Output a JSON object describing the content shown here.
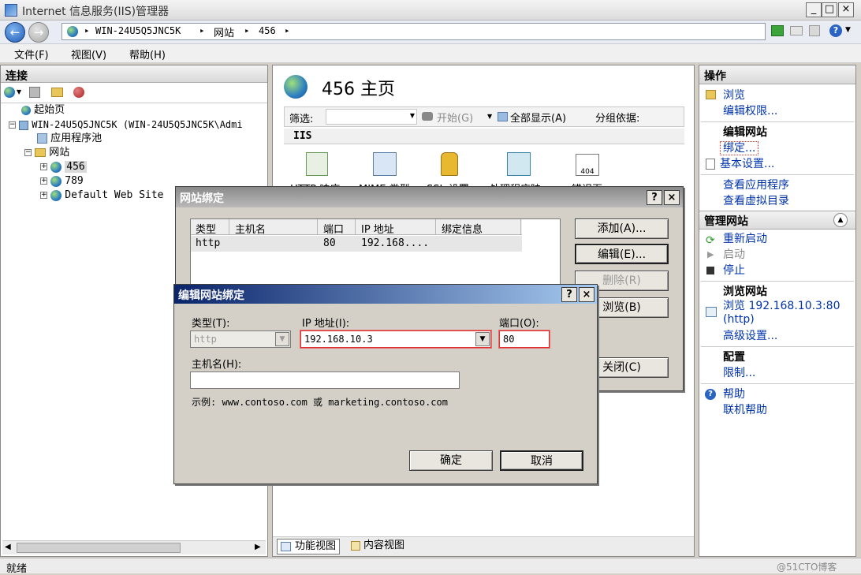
{
  "window": {
    "title": "Internet 信息服务(IIS)管理器",
    "min": "_",
    "max": "□",
    "close": "×"
  },
  "address": {
    "crumbs": [
      "WIN-24U5Q5JNC5K",
      "网站",
      "456"
    ],
    "sep": "▸"
  },
  "menubar": [
    "文件(F)",
    "视图(V)",
    "帮助(H)"
  ],
  "connections": {
    "title": "连接",
    "tree": {
      "start_page": "起始页",
      "server": "WIN-24U5Q5JNC5K (WIN-24U5Q5JNC5K\\Admi",
      "app_pools": "应用程序池",
      "sites": "网站",
      "site_456": "456",
      "site_789": "789",
      "default_site": "Default Web Site"
    }
  },
  "center": {
    "title": "456 主页",
    "filter_label": "筛选:",
    "start_label": "开始(G)",
    "show_all_label": "全部显示(A)",
    "group_label": "分组依据:",
    "section": "IIS",
    "icons": [
      "HTTP 响应",
      "MIME 类型",
      "SSL 设置",
      "处理程序映",
      "错误页"
    ],
    "icon_404": "404",
    "features_view": "功能视图",
    "content_view": "内容视图"
  },
  "actions": {
    "title": "操作",
    "browse": "浏览",
    "edit_permissions": "编辑权限...",
    "edit_site_head": "编辑网站",
    "bindings": "绑定...",
    "basic_settings": "基本设置...",
    "view_apps": "查看应用程序",
    "view_vdirs": "查看虚拟目录",
    "manage_site_head": "管理网站",
    "restart": "重新启动",
    "start": "启动",
    "stop": "停止",
    "browse_site_head": "浏览网站",
    "browse_line1": "浏览 192.168.10.3:80",
    "browse_line2": "(http)",
    "advanced": "高级设置...",
    "config_head": "配置",
    "limits": "限制...",
    "help": "帮助",
    "online_help": "联机帮助"
  },
  "bindings_dialog": {
    "title": "网站绑定",
    "help": "?",
    "close": "×",
    "columns": [
      "类型",
      "主机名",
      "端口",
      "IP 地址",
      "绑定信息"
    ],
    "rows": [
      {
        "type": "http",
        "host": "",
        "port": "80",
        "ip": "192.168....",
        "info": ""
      }
    ],
    "add": "添加(A)...",
    "edit": "编辑(E)...",
    "remove": "删除(R)",
    "browse": "浏览(B)",
    "close_btn": "关闭(C)"
  },
  "edit_dialog": {
    "title": "编辑网站绑定",
    "help": "?",
    "close": "×",
    "type_label": "类型(T):",
    "type_value": "http",
    "ip_label": "IP 地址(I):",
    "ip_value": "192.168.10.3",
    "port_label": "端口(O):",
    "port_value": "80",
    "host_label": "主机名(H):",
    "host_value": "",
    "example": "示例: www.contoso.com 或 marketing.contoso.com",
    "ok": "确定",
    "cancel": "取消"
  },
  "statusbar": {
    "text": "就绪",
    "watermark": "@51CTO博客"
  },
  "colors": {
    "accent_border": "#e03030",
    "title_active": "#0a246a",
    "link": "#0033aa"
  }
}
